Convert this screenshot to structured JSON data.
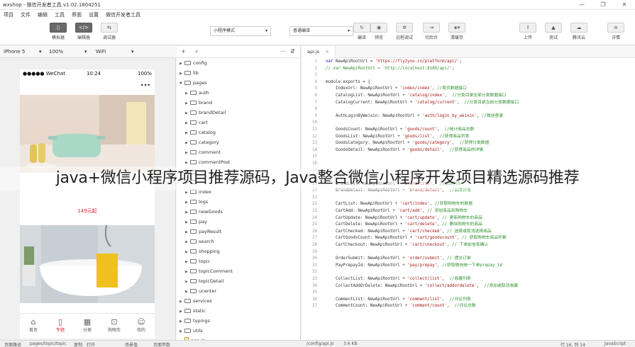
{
  "window": {
    "title": "wxshop - 微信开发者工具 v1.02.1804251",
    "controls": [
      "—",
      "❐",
      "✕"
    ]
  },
  "menu": [
    "项目",
    "文件",
    "编辑",
    "工具",
    "界面",
    "设置",
    "微信开发者工具"
  ],
  "toolbar": {
    "simulator": "模拟器",
    "editor": "编辑器",
    "debugger": "调试器",
    "mode_select": "小程序模式",
    "compile_select": "普通编译",
    "compile": "编译",
    "preview": "预览",
    "remote_debug": "远程调试",
    "background": "切后台",
    "clear_cache": "清缓存",
    "upload": "上传",
    "test": "测试",
    "tencent_cloud": "腾讯云",
    "details": "详情"
  },
  "device": {
    "model": "iPhone 5",
    "zoom": "100%",
    "network": "WiFi"
  },
  "phone": {
    "carrier": "●●●●● WeChat",
    "time": "10:24",
    "battery": "100%",
    "price": "149元起",
    "tabs": [
      {
        "label": "首页",
        "icon": "⌂"
      },
      {
        "label": "专题",
        "icon": "▯"
      },
      {
        "label": "分类",
        "icon": "▦"
      },
      {
        "label": "购物车",
        "icon": "⊡"
      },
      {
        "label": "我的",
        "icon": "☺"
      }
    ]
  },
  "explorer": {
    "tree": [
      {
        "name": "config",
        "type": "folder",
        "depth": 1,
        "open": false
      },
      {
        "name": "lib",
        "type": "folder",
        "depth": 1,
        "open": false
      },
      {
        "name": "pages",
        "type": "folder",
        "depth": 1,
        "open": true
      },
      {
        "name": "auth",
        "type": "folder",
        "depth": 2,
        "open": false
      },
      {
        "name": "brand",
        "type": "folder",
        "depth": 2,
        "open": false
      },
      {
        "name": "brandDetail",
        "type": "folder",
        "depth": 2,
        "open": false
      },
      {
        "name": "cart",
        "type": "folder",
        "depth": 2,
        "open": false
      },
      {
        "name": "catalog",
        "type": "folder",
        "depth": 2,
        "open": false
      },
      {
        "name": "category",
        "type": "folder",
        "depth": 2,
        "open": false
      },
      {
        "name": "comment",
        "type": "folder",
        "depth": 2,
        "open": false
      },
      {
        "name": "commentPost",
        "type": "folder",
        "depth": 2,
        "open": false
      },
      {
        "name": "",
        "type": "folder",
        "depth": 2,
        "open": false
      },
      {
        "name": "",
        "type": "folder",
        "depth": 2,
        "open": false
      },
      {
        "name": "index",
        "type": "folder",
        "depth": 2,
        "open": false
      },
      {
        "name": "logs",
        "type": "folder",
        "depth": 2,
        "open": false
      },
      {
        "name": "newGoods",
        "type": "folder",
        "depth": 2,
        "open": false
      },
      {
        "name": "pay",
        "type": "folder",
        "depth": 2,
        "open": false
      },
      {
        "name": "payResult",
        "type": "folder",
        "depth": 2,
        "open": false
      },
      {
        "name": "search",
        "type": "folder",
        "depth": 2,
        "open": false
      },
      {
        "name": "shopping",
        "type": "folder",
        "depth": 2,
        "open": false
      },
      {
        "name": "topic",
        "type": "folder",
        "depth": 2,
        "open": false
      },
      {
        "name": "topicComment",
        "type": "folder",
        "depth": 2,
        "open": false
      },
      {
        "name": "topicDetail",
        "type": "folder",
        "depth": 2,
        "open": false
      },
      {
        "name": "ucenter",
        "type": "folder",
        "depth": 2,
        "open": false
      },
      {
        "name": "services",
        "type": "folder",
        "depth": 1,
        "open": false
      },
      {
        "name": "static",
        "type": "folder",
        "depth": 1,
        "open": false
      },
      {
        "name": "typings",
        "type": "folder",
        "depth": 1,
        "open": false
      },
      {
        "name": "utils",
        "type": "folder",
        "depth": 1,
        "open": false
      },
      {
        "name": "app.js",
        "type": "file",
        "depth": 1,
        "open": false
      }
    ]
  },
  "editor": {
    "tab": "api.js",
    "lines": [
      {
        "n": "1",
        "parts": [
          [
            "kw",
            "var "
          ],
          [
            "",
            "NewApiRootUrl = "
          ],
          [
            "str",
            "'https://fly2you.cn/platform/api/'"
          ],
          [
            "",
            ";"
          ]
        ]
      },
      {
        "n": "2",
        "parts": [
          [
            "cmt",
            "// var NewApiRootUrl = 'http://localhost:8180/api/';"
          ]
        ]
      },
      {
        "n": "3",
        "parts": []
      },
      {
        "n": "4",
        "parts": [
          [
            "",
            "module.exports = {"
          ]
        ]
      },
      {
        "n": "5",
        "parts": [
          [
            "",
            "    IndexUrl: NewApiRootUrl + "
          ],
          [
            "str",
            "'index/index'"
          ],
          [
            "",
            ", "
          ],
          [
            "cmt",
            "//首页数据接口"
          ]
        ]
      },
      {
        "n": "6",
        "parts": [
          [
            "",
            "    CatalogList: NewApiRootUrl + "
          ],
          [
            "str",
            "'catalog/index'"
          ],
          [
            "",
            ",  "
          ],
          [
            "cmt",
            "//分类目录全部分类数据接口"
          ]
        ]
      },
      {
        "n": "7",
        "parts": [
          [
            "",
            "    CatalogCurrent: NewApiRootUrl + "
          ],
          [
            "str",
            "'catalog/current'"
          ],
          [
            "",
            ",  "
          ],
          [
            "cmt",
            "//分类目录当前分类数据接口"
          ]
        ]
      },
      {
        "n": "8",
        "parts": []
      },
      {
        "n": "9",
        "parts": [
          [
            "",
            "    AuthLoginByWeixin: NewApiRootUrl + "
          ],
          [
            "str",
            "'auth/login_by_weixin'"
          ],
          [
            "",
            ", "
          ],
          [
            "cmt",
            "//微信登录"
          ]
        ]
      },
      {
        "n": "10",
        "parts": []
      },
      {
        "n": "11",
        "parts": [
          [
            "",
            "    GoodsCount: NewApiRootUrl + "
          ],
          [
            "str",
            "'goods/count'"
          ],
          [
            "",
            ",  "
          ],
          [
            "cmt",
            "//统计商品总数"
          ]
        ]
      },
      {
        "n": "12",
        "parts": [
          [
            "",
            "    GoodsList: NewApiRootUrl + "
          ],
          [
            "str",
            "'goods/list'"
          ],
          [
            "",
            ",  "
          ],
          [
            "cmt",
            "//获得商品列表"
          ]
        ]
      },
      {
        "n": "13",
        "parts": [
          [
            "",
            "    GoodsCategory: NewApiRootUrl + "
          ],
          [
            "str",
            "'goods/category'"
          ],
          [
            "",
            ",  "
          ],
          [
            "cmt",
            "//获得分类数据"
          ]
        ]
      },
      {
        "n": "14",
        "parts": [
          [
            "",
            "    GoodsDetail: NewApiRootUrl + "
          ],
          [
            "str",
            "'goods/detail'"
          ],
          [
            "",
            ",  "
          ],
          [
            "cmt",
            "//获得商品的详情"
          ]
        ]
      },
      {
        "n": "15",
        "parts": []
      },
      {
        "n": "16",
        "parts": []
      },
      {
        "n": "17",
        "parts": []
      },
      {
        "n": "18",
        "parts": []
      },
      {
        "n": "19",
        "parts": [
          [
            "",
            "    BrandList: NewApiRootUrl + "
          ],
          [
            "str",
            "'brand/list'"
          ],
          [
            "",
            ",  "
          ],
          [
            "cmt",
            "//品牌列表"
          ]
        ]
      },
      {
        "n": "20",
        "parts": [
          [
            "",
            "    BrandDetail: NewApiRootUrl + "
          ],
          [
            "str",
            "'brand/detail'"
          ],
          [
            "",
            ",  "
          ],
          [
            "cmt",
            "//品牌详情"
          ]
        ]
      },
      {
        "n": "21",
        "parts": []
      },
      {
        "n": "22",
        "parts": [
          [
            "",
            "    CartList: NewApiRootUrl + "
          ],
          [
            "str",
            "'cart/index'"
          ],
          [
            "",
            ", "
          ],
          [
            "cmt",
            "//获取购物车的数据"
          ]
        ]
      },
      {
        "n": "23",
        "parts": [
          [
            "",
            "    CartAdd: NewApiRootUrl + "
          ],
          [
            "str",
            "'cart/add'"
          ],
          [
            "",
            ", "
          ],
          [
            "cmt",
            "// 添加商品到购物车"
          ]
        ]
      },
      {
        "n": "24",
        "parts": [
          [
            "",
            "    CartUpdate: NewApiRootUrl + "
          ],
          [
            "str",
            "'cart/update'"
          ],
          [
            "",
            ", "
          ],
          [
            "cmt",
            "// 更新购物车的商品"
          ]
        ]
      },
      {
        "n": "25",
        "parts": [
          [
            "",
            "    CartDelete: NewApiRootUrl + "
          ],
          [
            "str",
            "'cart/delete'"
          ],
          [
            "",
            ", "
          ],
          [
            "cmt",
            "// 删除购物车的商品"
          ]
        ]
      },
      {
        "n": "26",
        "parts": [
          [
            "",
            "    CartChecked: NewApiRootUrl + "
          ],
          [
            "str",
            "'cart/checked'"
          ],
          [
            "",
            ", "
          ],
          [
            "cmt",
            "// 选择或取消选择商品"
          ]
        ]
      },
      {
        "n": "27",
        "parts": [
          [
            "",
            "    CartGoodsCount: NewApiRootUrl + "
          ],
          [
            "str",
            "'cart/goodscount'"
          ],
          [
            "",
            ", "
          ],
          [
            "cmt",
            "// 获取购物车商品件数"
          ]
        ]
      },
      {
        "n": "28",
        "parts": [
          [
            "",
            "    CartCheckout: NewApiRootUrl + "
          ],
          [
            "str",
            "'cart/checkout'"
          ],
          [
            "",
            ", "
          ],
          [
            "cmt",
            "// 下单前信息确认"
          ]
        ]
      },
      {
        "n": "29",
        "parts": []
      },
      {
        "n": "30",
        "parts": [
          [
            "",
            "    OrderSubmit: NewApiRootUrl + "
          ],
          [
            "str",
            "'order/submit'"
          ],
          [
            "",
            ", "
          ],
          [
            "cmt",
            "// 提交订单"
          ]
        ]
      },
      {
        "n": "31",
        "parts": [
          [
            "",
            "    PayPrepayId: NewApiRootUrl + "
          ],
          [
            "str",
            "'pay/prepay'"
          ],
          [
            "",
            ", "
          ],
          [
            "cmt",
            "//获取微信统一下单prepay_id"
          ]
        ]
      },
      {
        "n": "32",
        "parts": []
      },
      {
        "n": "33",
        "parts": [
          [
            "",
            "    CollectList: NewApiRootUrl + "
          ],
          [
            "str",
            "'collect/list'"
          ],
          [
            "",
            ",  "
          ],
          [
            "cmt",
            "//收藏列表"
          ]
        ]
      },
      {
        "n": "34",
        "parts": [
          [
            "",
            "    CollectAddOrDelete: NewApiRootUrl + "
          ],
          [
            "str",
            "'collect/addordelete'"
          ],
          [
            "",
            ",  "
          ],
          [
            "cmt",
            "//添加或取消收藏"
          ]
        ]
      },
      {
        "n": "35",
        "parts": []
      },
      {
        "n": "36",
        "parts": [
          [
            "",
            "    CommentList: NewApiRootUrl + "
          ],
          [
            "str",
            "'comment/list'"
          ],
          [
            "",
            ",  "
          ],
          [
            "cmt",
            "//评论列表"
          ]
        ]
      },
      {
        "n": "37",
        "parts": [
          [
            "",
            "    CommentCount: NewApiRootUrl + "
          ],
          [
            "str",
            "'comment/count'"
          ],
          [
            "",
            ",  "
          ],
          [
            "cmt",
            "//评论总数"
          ]
        ]
      }
    ]
  },
  "statusbar": {
    "page_path_label": "页面路径",
    "page_path": "pages/topic/topic",
    "copy": "复制",
    "open": "打开",
    "scene_label": "场景值",
    "params_label": "页面参数",
    "file_path": "/config/api.js",
    "file_size": "3.6 KB",
    "cursor": "行 16, 列 14",
    "language": "JavaScript"
  },
  "overlay_text": "java+微信小程序项目推荐源码，Java整合微信小程序开发项目精选源码推荐",
  "colors": {
    "accent_red": "#dd2233",
    "string": "#a31515",
    "comment": "#2f8f2f",
    "keyword": "#0000cc"
  }
}
